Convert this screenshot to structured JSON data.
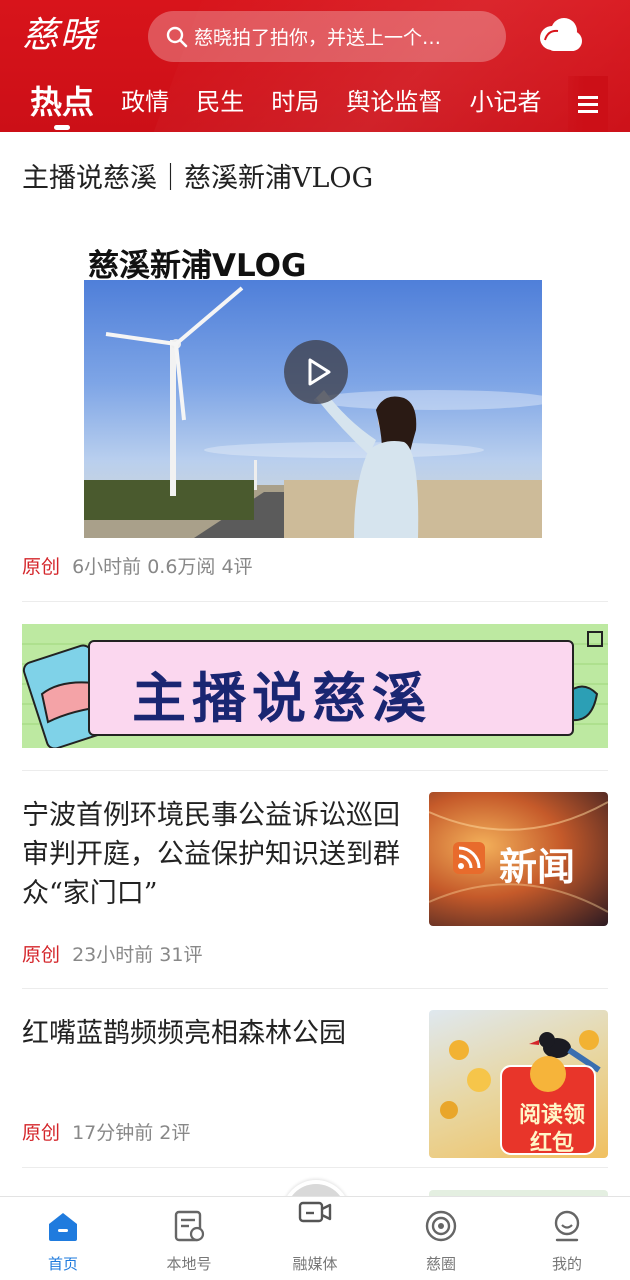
{
  "header": {
    "logo_text": "慈晓",
    "search_placeholder": "慈晓拍了拍你，并送上一个…",
    "weather_icon": "cloud-icon",
    "brand_color": "#d8141b"
  },
  "nav": {
    "tabs": [
      {
        "label": "热点",
        "active": true
      },
      {
        "label": "政情"
      },
      {
        "label": "民生"
      },
      {
        "label": "时局"
      },
      {
        "label": "舆论监督"
      },
      {
        "label": "小记者"
      }
    ],
    "menu_icon": "menu-icon"
  },
  "feed": {
    "section_title": "主播说慈溪｜慈溪新浦VLOG",
    "video": {
      "title": "慈溪新浦VLOG",
      "meta": {
        "tag": "原创",
        "time": "6小时前",
        "reads": "0.6万阅",
        "comments": "4评"
      }
    },
    "banner": {
      "text": "主播说慈溪"
    },
    "articles": [
      {
        "title": "宁波首例环境民事公益诉讼巡回审判开庭，公益保护知识送到群众“家门口”",
        "thumb_text": "新闻",
        "meta": {
          "tag": "原创",
          "time": "23小时前",
          "comments": "31评"
        }
      },
      {
        "title": "红嘴蓝鹊频频亮相森林公园",
        "thumb_text": "阅读领红包",
        "meta": {
          "tag": "原创",
          "time": "17分钟前",
          "comments": "2评"
        }
      }
    ]
  },
  "tabbar": {
    "items": [
      {
        "label": "首页",
        "icon": "home-icon",
        "active": true
      },
      {
        "label": "本地号",
        "icon": "local-account-icon"
      },
      {
        "label": "融媒体",
        "icon": "video-camera-icon"
      },
      {
        "label": "慈圈",
        "icon": "circle-icon"
      },
      {
        "label": "我的",
        "icon": "profile-icon"
      }
    ],
    "active_color": "#1f7bde"
  }
}
